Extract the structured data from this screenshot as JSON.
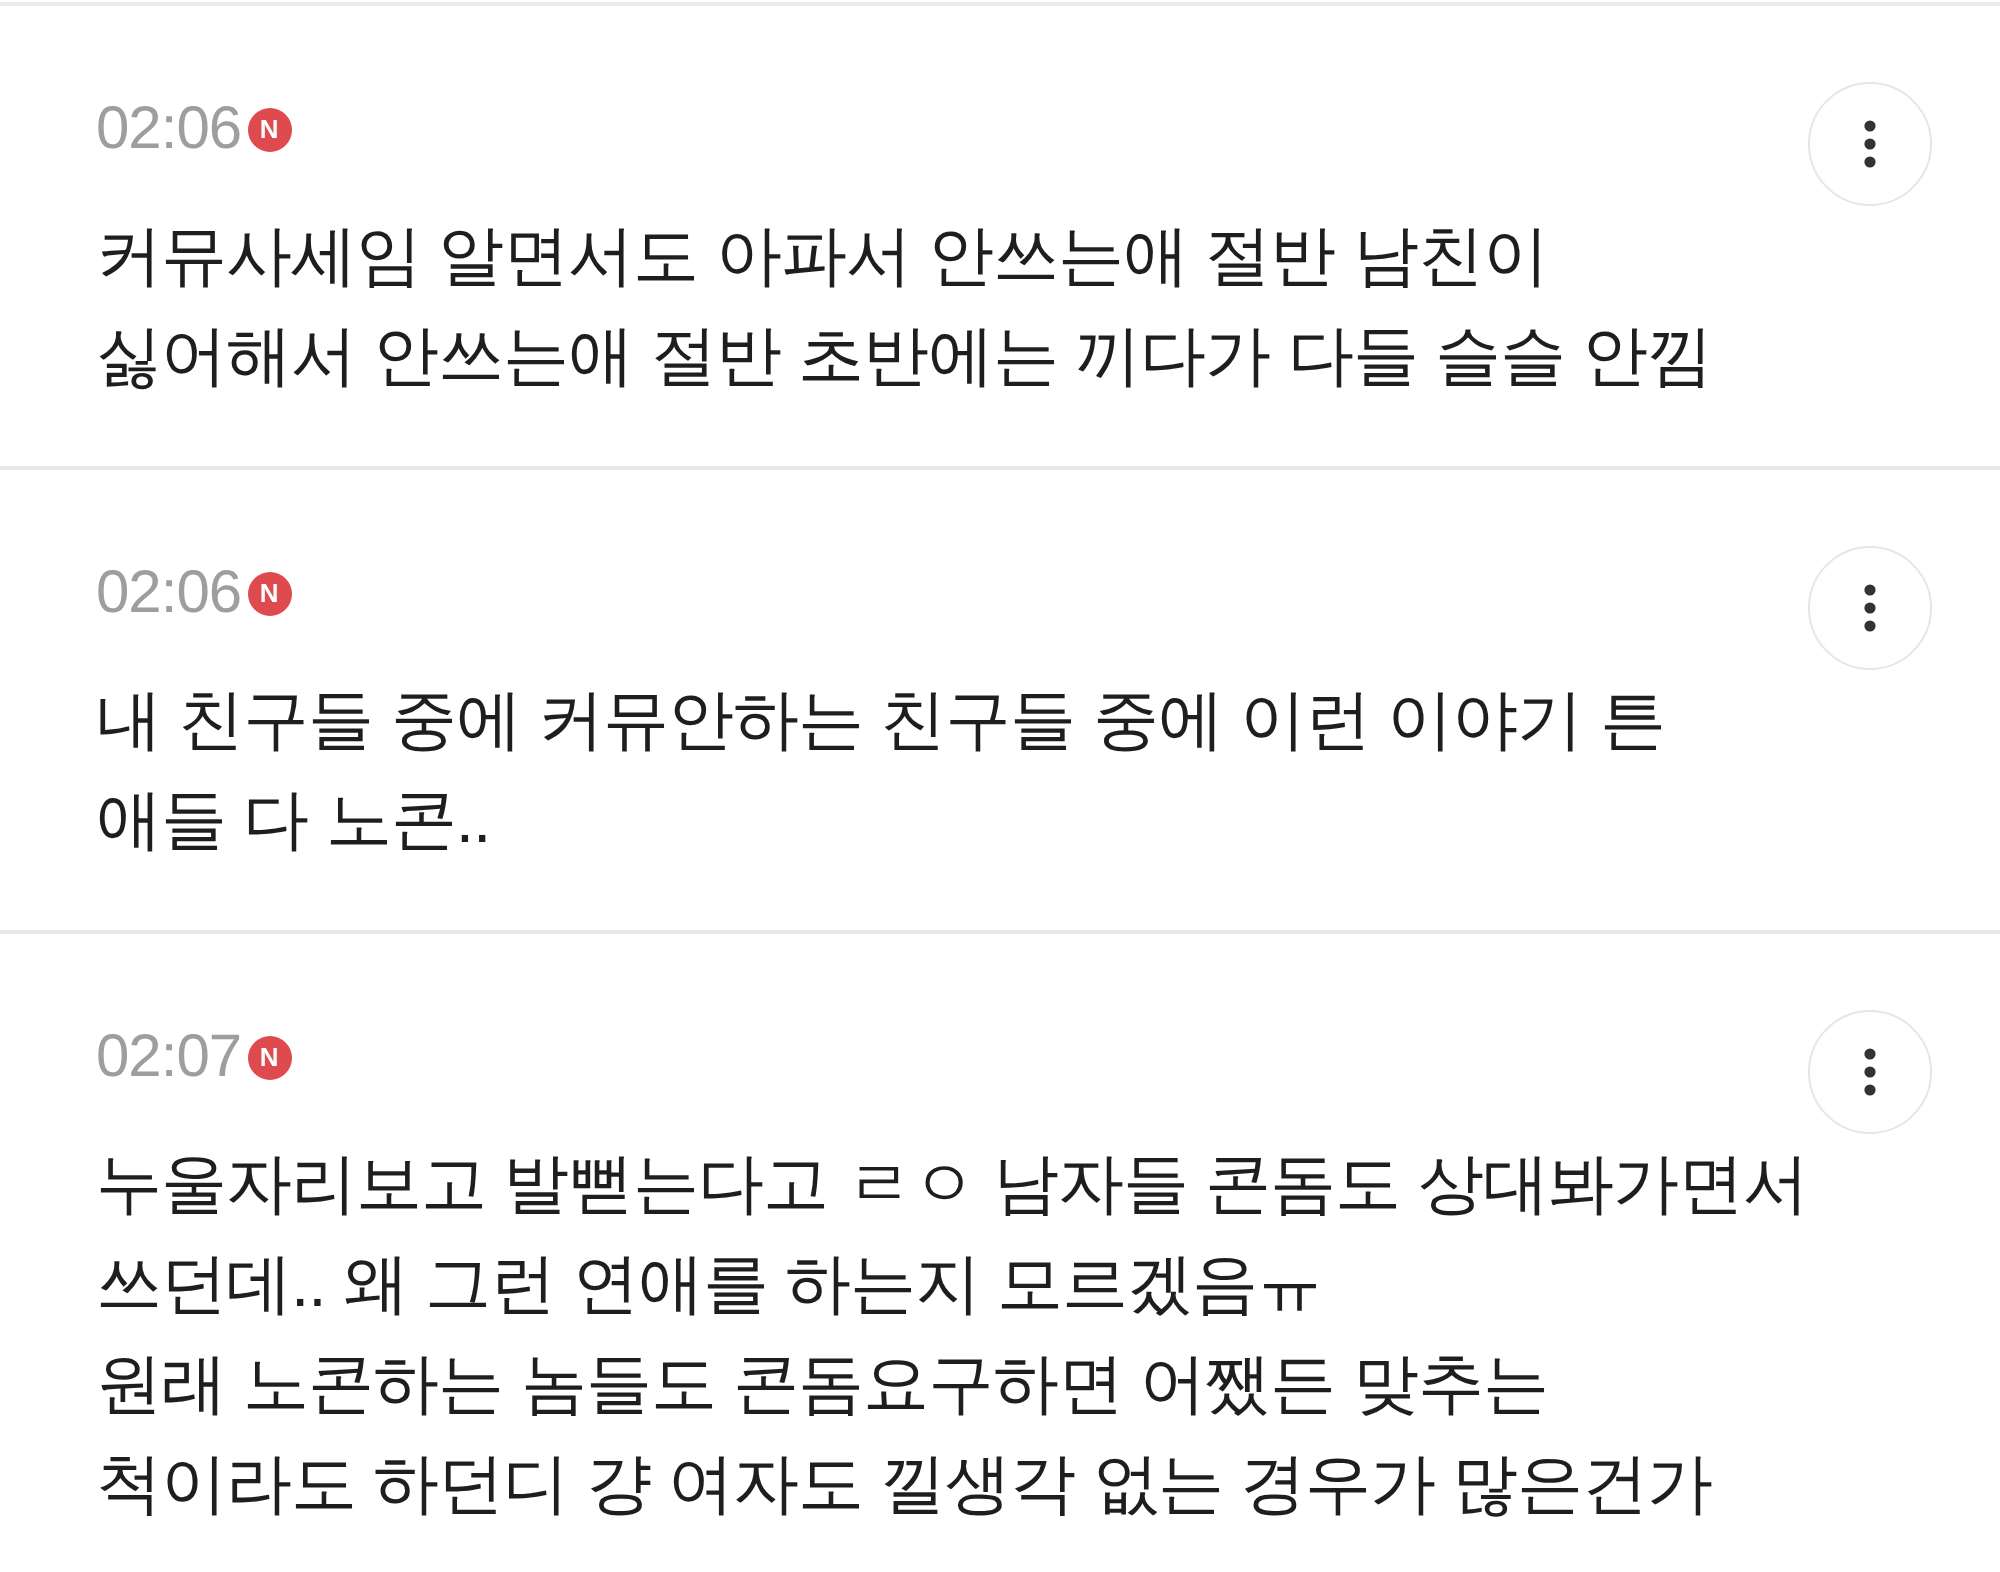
{
  "comments": [
    {
      "time": "02:06",
      "badge": "N",
      "lines": [
        "커뮤사세임 알면서도 아파서 안쓰는애 절반 남친이",
        "싫어해서 안쓰는애 절반 초반에는 끼다가 다들 슬슬 안낌"
      ]
    },
    {
      "time": "02:06",
      "badge": "N",
      "lines": [
        "내 친구들 중에 커뮤안하는 친구들 중에 이런 이야기 튼",
        "애들 다 노콘.."
      ]
    },
    {
      "time": "02:07",
      "badge": "N",
      "lines": [
        "누울자리보고 발뻗는다고 ㄹㅇ 남자들 콘돔도 상대봐가면서",
        "쓰던데.. 왜 그런 연애를 하는지 모르겠음ㅠ",
        "원래 노콘하는 놈들도 콘돔요구하면 어쨌든 맞추는",
        "척이라도 하던디 걍 여자도 낄생각 없는 경우가 많은건가"
      ]
    }
  ]
}
